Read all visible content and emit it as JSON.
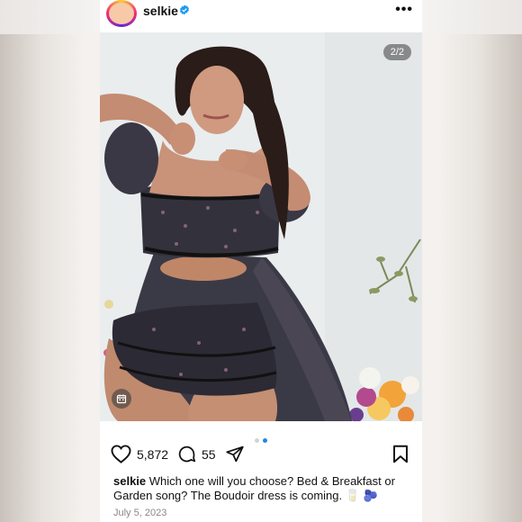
{
  "post": {
    "username": "selkie",
    "verified_icon": "verified-badge-icon",
    "more_icon": "more-horizontal-icon",
    "image_counter": "2/2",
    "carousel": {
      "total": 2,
      "active_index": 1
    },
    "likes": "5,872",
    "comments": "55",
    "caption_user": "selkie",
    "caption_text": "Which one will you choose? Bed & Breakfast or Garden song? The Boudoir dress is coming. 🥛 🫐",
    "date": "July 5, 2023"
  },
  "icons": {
    "like": "heart-icon",
    "comment": "comment-bubble-icon",
    "share": "send-icon",
    "save": "bookmark-icon",
    "calendar": "calendar-icon"
  },
  "colors": {
    "accent": "#1e88e5",
    "verified": "#1d9bf0",
    "text": "#111111",
    "muted": "#888888"
  }
}
